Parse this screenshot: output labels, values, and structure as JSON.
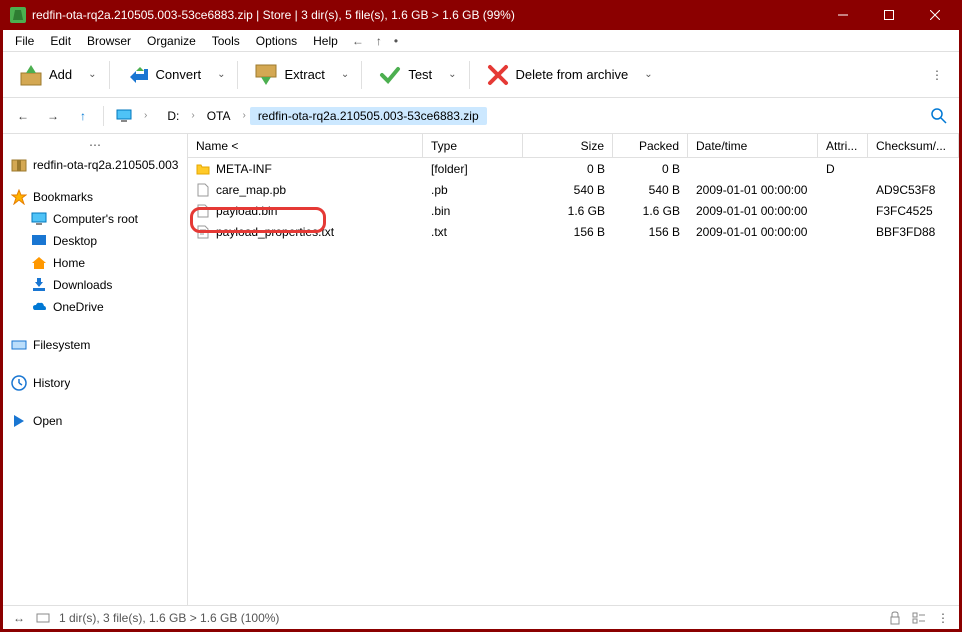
{
  "titlebar": {
    "text": "redfin-ota-rq2a.210505.003-53ce6883.zip | Store | 3 dir(s), 5 file(s), 1.6 GB > 1.6 GB (99%)"
  },
  "menubar": {
    "items": [
      "File",
      "Edit",
      "Browser",
      "Organize",
      "Tools",
      "Options",
      "Help"
    ]
  },
  "toolbar": {
    "add": "Add",
    "convert": "Convert",
    "extract": "Extract",
    "test": "Test",
    "delete": "Delete from archive"
  },
  "breadcrumb": {
    "items": [
      "D:",
      "OTA",
      "redfin-ota-rq2a.210505.003-53ce6883.zip"
    ]
  },
  "columns": {
    "name": "Name <",
    "type": "Type",
    "size": "Size",
    "packed": "Packed",
    "date": "Date/time",
    "attri": "Attri...",
    "checksum": "Checksum/..."
  },
  "sidebar": {
    "archive": "redfin-ota-rq2a.210505.003",
    "bookmarks": "Bookmarks",
    "items": [
      "Computer's root",
      "Desktop",
      "Home",
      "Downloads",
      "OneDrive"
    ],
    "filesystem": "Filesystem",
    "history": "History",
    "open": "Open"
  },
  "files": [
    {
      "name": "META-INF",
      "type": "[folder]",
      "size": "0 B",
      "packed": "0 B",
      "date": "",
      "attri": "D",
      "check": ""
    },
    {
      "name": "care_map.pb",
      "type": ".pb",
      "size": "540 B",
      "packed": "540 B",
      "date": "2009-01-01 00:00:00",
      "attri": "",
      "check": "AD9C53F8"
    },
    {
      "name": "payload.bin",
      "type": ".bin",
      "size": "1.6 GB",
      "packed": "1.6 GB",
      "date": "2009-01-01 00:00:00",
      "attri": "",
      "check": "F3FC4525"
    },
    {
      "name": "payload_properties.txt",
      "type": ".txt",
      "size": "156 B",
      "packed": "156 B",
      "date": "2009-01-01 00:00:00",
      "attri": "",
      "check": "BBF3FD88"
    }
  ],
  "statusbar": {
    "text": "1 dir(s), 3 file(s), 1.6 GB > 1.6 GB (100%)"
  }
}
